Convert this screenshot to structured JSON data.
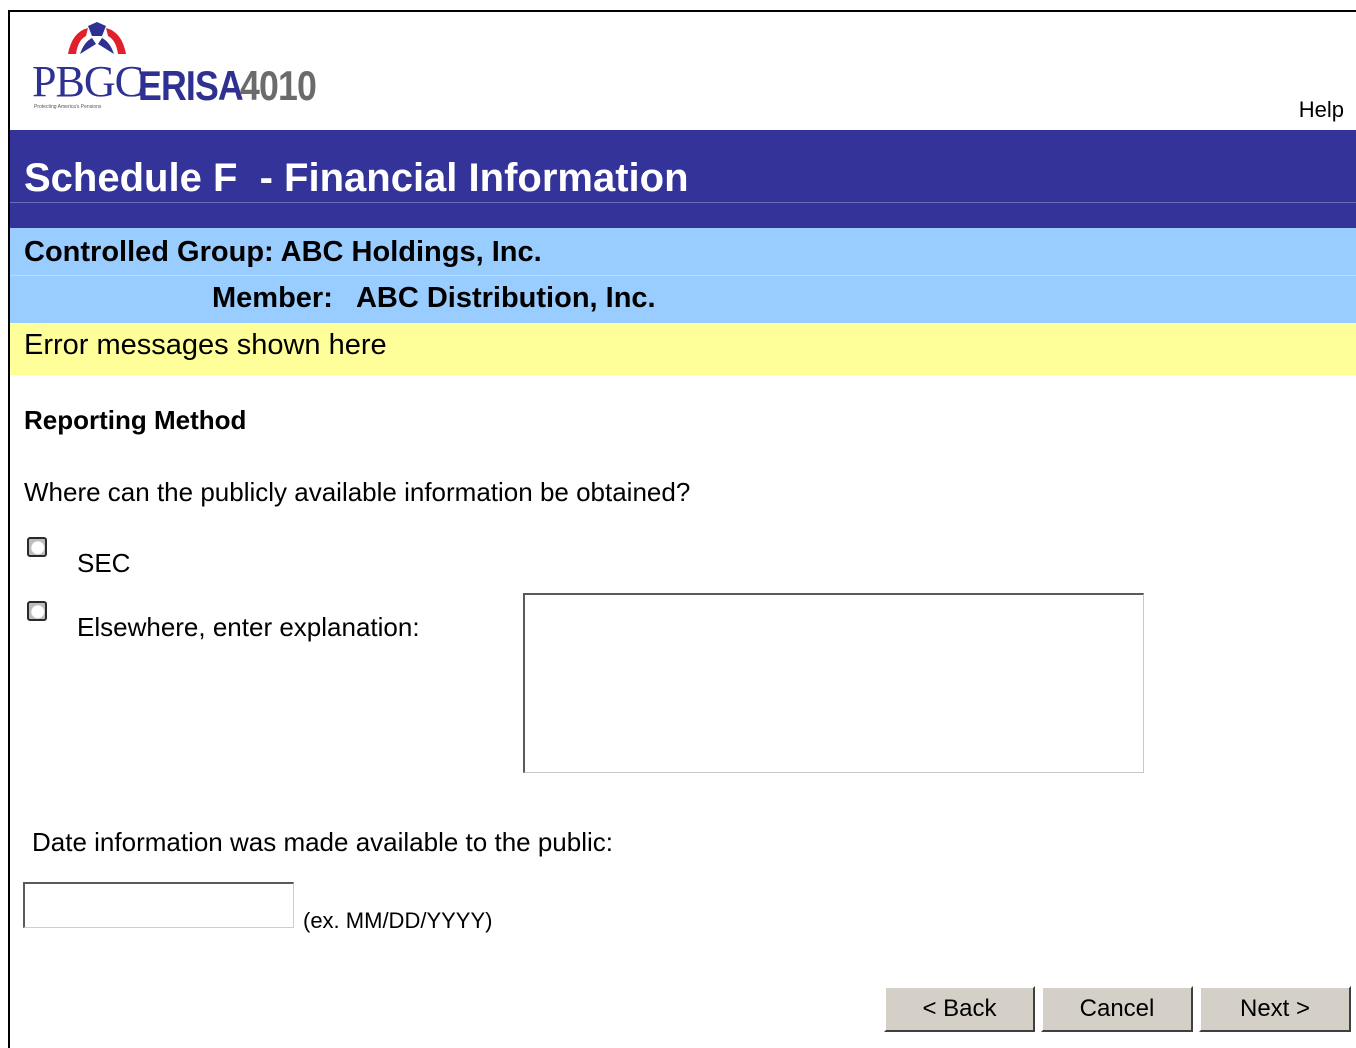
{
  "header": {
    "logo_main": "PBGC",
    "logo_erisa": "ERISA",
    "logo_number": "4010",
    "logo_tagline": "Protecting America's Pensions",
    "help_link": "Help"
  },
  "title": "Schedule F  - Financial Information",
  "group": {
    "controlled_group": "Controlled Group: ABC Holdings, Inc.",
    "member": "Member:   ABC Distribution, Inc."
  },
  "error_message": "Error messages shown here",
  "form": {
    "section_heading": "Reporting Method",
    "question": "Where can the publicly available information be obtained?",
    "options": [
      {
        "label": "SEC",
        "selected": false
      },
      {
        "label": "Elsewhere, enter explanation:",
        "selected": false
      }
    ],
    "explanation_value": "",
    "date_label": "Date information was made available to the public:",
    "date_value": "",
    "date_hint": "(ex. MM/DD/YYYY)"
  },
  "buttons": {
    "back": "< Back",
    "cancel": "Cancel",
    "next": "Next >"
  },
  "colors": {
    "title_bar": "#333399",
    "group_bar": "#99ccff",
    "error_bar": "#ffff99",
    "logo_blue": "#2e3192",
    "logo_red": "#e0202a"
  }
}
